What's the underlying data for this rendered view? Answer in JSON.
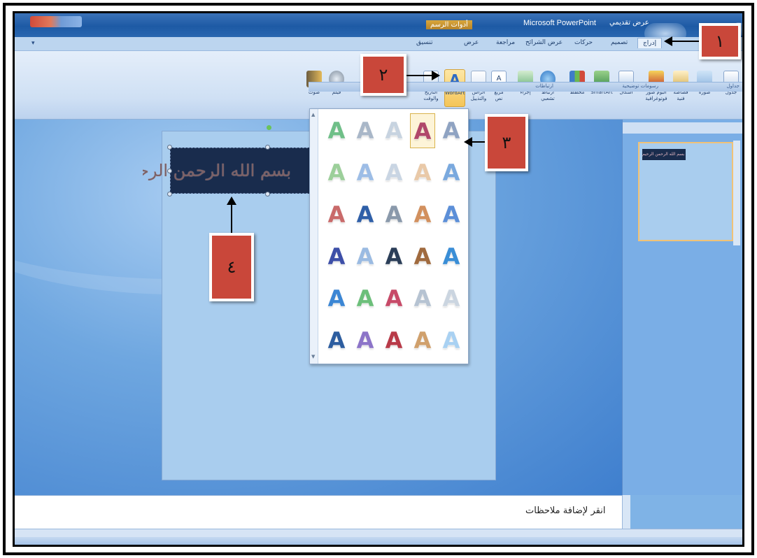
{
  "window": {
    "app_title": "Microsoft PowerPoint",
    "context_tab": "أدوات الرسم",
    "document_title": "عرض تقديمي"
  },
  "ribbon": {
    "tabs": [
      {
        "label": "إدراج",
        "active": true
      },
      {
        "label": "تصميم"
      },
      {
        "label": "حركات"
      },
      {
        "label": "عرض الشرائح"
      },
      {
        "label": "مراجعة"
      },
      {
        "label": "عرض"
      },
      {
        "label": "تنسيق"
      }
    ],
    "buttons": [
      {
        "label": "جدول",
        "icon": "table-icon"
      },
      {
        "label": "صورة",
        "icon": "picture-icon"
      },
      {
        "label": "قصاصة فنية",
        "icon": "clipart-icon"
      },
      {
        "label": "ألبوم صور فوتوغرافية",
        "icon": "photo-album-icon"
      },
      {
        "label": "أشكال",
        "icon": "shapes-icon"
      },
      {
        "label": "SmartArt",
        "icon": "smartart-icon"
      },
      {
        "label": "مخطط",
        "icon": "chart-icon"
      },
      {
        "label": "ارتباط تشعبي",
        "icon": "hyperlink-icon"
      },
      {
        "label": "إجراء",
        "icon": "action-icon"
      },
      {
        "label": "مربع نص",
        "icon": "textbox-icon"
      },
      {
        "label": "الرأس والتذييل",
        "icon": "header-footer-icon"
      },
      {
        "label": "WordArt",
        "icon": "wordart-icon",
        "highlighted": true
      },
      {
        "label": "التاريخ والوقت",
        "icon": "date-time-icon"
      },
      {
        "label": "فيلم",
        "icon": "movie-icon"
      },
      {
        "label": "صوت",
        "icon": "sound-icon"
      }
    ],
    "groups": [
      "جداول",
      "رسومات توضيحية",
      "ارتباطات",
      "نص",
      "وسائط"
    ]
  },
  "wordart_gallery": {
    "glyph": "A",
    "rows": [
      [
        "#6fbf88",
        "#a9b7c8",
        "#c7d3e0",
        "#b0476a",
        "#8fa3c2"
      ],
      [
        "#9ccf9a",
        "#9dbde6",
        "#c9d5e3",
        "#e9c9a8",
        "#7aa9de"
      ],
      [
        "#c96a6a",
        "#2f5fa8",
        "#8a99ab",
        "#d2905e",
        "#5c8fd8"
      ],
      [
        "#3d4fa8",
        "#9bbbe2",
        "#2b3e58",
        "#a06a3e",
        "#3a8ed6"
      ],
      [
        "#3b86d4",
        "#6cbf7a",
        "#c74a68",
        "#b6c3d2",
        "#cbd5e0"
      ],
      [
        "#2d5d9f",
        "#8c74c8",
        "#b83a48",
        "#d0a06c",
        "#a9d1f2"
      ]
    ]
  },
  "slide": {
    "title_text": "بسم الله الرحمن الرحيم"
  },
  "thumbnail": {
    "title_text": "بسم الله الرحمن الرحيم"
  },
  "notes": {
    "placeholder": "انقر لإضافة ملاحظات"
  },
  "callouts": [
    {
      "label": "١",
      "target": "insert-tab"
    },
    {
      "label": "٢",
      "target": "wordart-button"
    },
    {
      "label": "٣",
      "target": "wordart-style"
    },
    {
      "label": "٤",
      "target": "slide-title-box"
    }
  ]
}
